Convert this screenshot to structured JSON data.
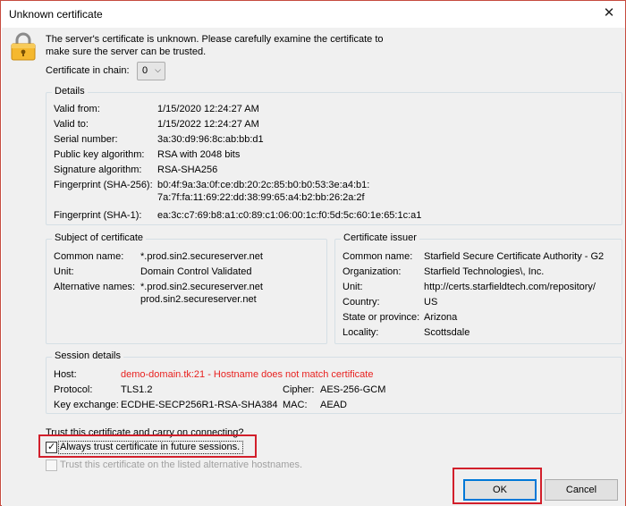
{
  "window": {
    "title": "Unknown certificate",
    "close_glyph": "✕"
  },
  "message": "The server's certificate is unknown. Please carefully examine the certificate to make sure the server can be trusted.",
  "chain": {
    "label": "Certificate in chain:",
    "value": "0"
  },
  "details": {
    "title": "Details",
    "rows": [
      {
        "label": "Valid from:",
        "value": "1/15/2020 12:24:27 AM"
      },
      {
        "label": "Valid to:",
        "value": "1/15/2022 12:24:27 AM"
      },
      {
        "label": "Serial number:",
        "value": "3a:30:d9:96:8c:ab:bb:d1"
      },
      {
        "label": "Public key algorithm:",
        "value": "RSA with 2048 bits"
      },
      {
        "label": "Signature algorithm:",
        "value": "RSA-SHA256"
      },
      {
        "label": "Fingerprint (SHA-256):",
        "value": "b0:4f:9a:3a:0f:ce:db:20:2c:85:b0:b0:53:3e:a4:b1:",
        "value2": "7a:7f:fa:11:69:22:dd:38:99:65:a4:b2:bb:26:2a:2f"
      },
      {
        "label": "Fingerprint (SHA-1):",
        "value": "ea:3c:c7:69:b8:a1:c0:89:c1:06:00:1c:f0:5d:5c:60:1e:65:1c:a1"
      }
    ]
  },
  "subject": {
    "title": "Subject of certificate",
    "rows": [
      {
        "label": "Common name:",
        "value": "*.prod.sin2.secureserver.net"
      },
      {
        "label": "Unit:",
        "value": "Domain Control Validated"
      },
      {
        "label": "Alternative names:",
        "value": "*.prod.sin2.secureserver.net",
        "value2": "prod.sin2.secureserver.net"
      }
    ]
  },
  "issuer": {
    "title": "Certificate issuer",
    "rows": [
      {
        "label": "Common name:",
        "value": "Starfield Secure Certificate Authority - G2"
      },
      {
        "label": "Organization:",
        "value": "Starfield Technologies\\, Inc."
      },
      {
        "label": "Unit:",
        "value": "http://certs.starfieldtech.com/repository/"
      },
      {
        "label": "Country:",
        "value": "US"
      },
      {
        "label": "State or province:",
        "value": "Arizona"
      },
      {
        "label": "Locality:",
        "value": "Scottsdale"
      }
    ]
  },
  "session": {
    "title": "Session details",
    "host_label": "Host:",
    "host_value": "demo-domain.tk:21 - Hostname does not match certificate",
    "protocol_label": "Protocol:",
    "protocol_value": "TLS1.2",
    "cipher_label": "Cipher:",
    "cipher_value": "AES-256-GCM",
    "kex_label": "Key exchange:",
    "kex_value": "ECDHE-SECP256R1-RSA-SHA384",
    "mac_label": "MAC:",
    "mac_value": "AEAD"
  },
  "trust": {
    "question": "Trust this certificate and carry on connecting?",
    "always_label": "Always trust certificate in future sessions.",
    "always_checked": true,
    "alt_label": "Trust this certificate on the listed alternative hostnames.",
    "alt_checked": false
  },
  "buttons": {
    "ok": "OK",
    "cancel": "Cancel"
  },
  "colors": {
    "warning_text": "#e8211f",
    "highlight": "#d21f2b",
    "lock_body": "#f5b82e"
  },
  "icons": {
    "lock": "lock-icon",
    "close": "close-icon",
    "dropdown": "chevron-down-icon",
    "check": "checkmark-icon"
  }
}
